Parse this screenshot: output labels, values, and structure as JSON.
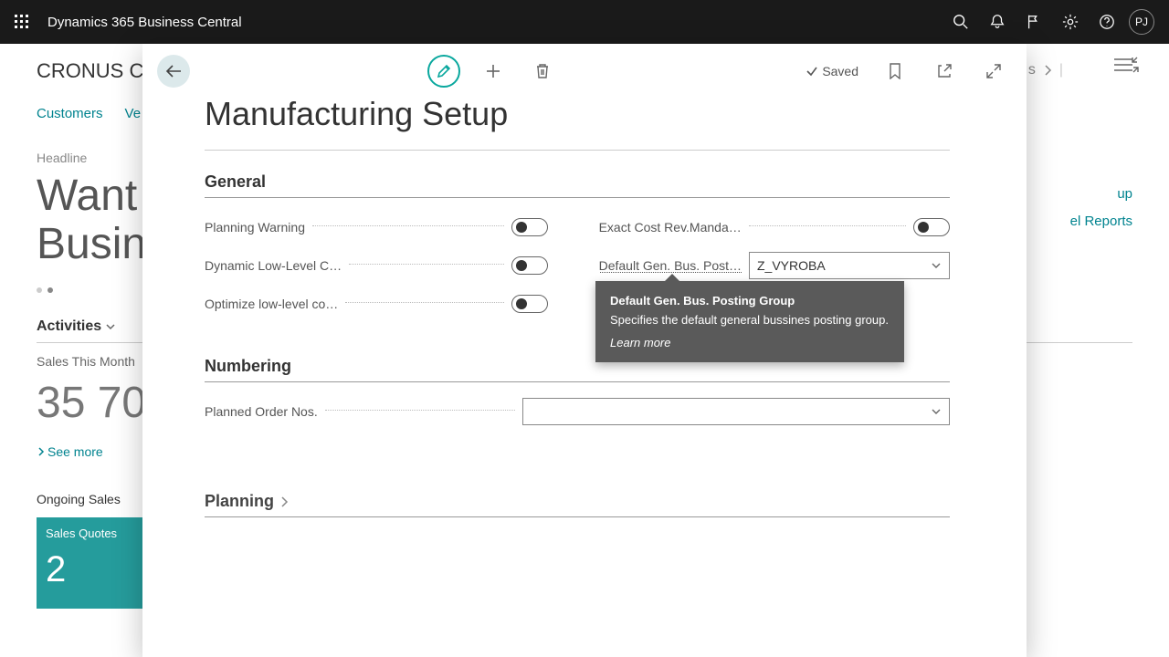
{
  "topbar": {
    "product": "Dynamics 365 Business Central",
    "avatar_initials": "PJ"
  },
  "background": {
    "company": "CRONUS CZ",
    "nav": {
      "customers": "Customers",
      "vendors_initial": "Ve"
    },
    "headline_label": "Headline",
    "headline_line1": "Want",
    "headline_line2": "Busine",
    "activities_header": "Activities",
    "sales_this_month_label": "Sales This Month",
    "sales_this_month_value": "35 70",
    "see_more": "See more",
    "ongoing_sales": "Ongoing Sales",
    "tile": {
      "label": "Sales Quotes",
      "value": "2"
    },
    "side_links": {
      "l1": "up",
      "l2": "el Reports"
    },
    "nav_suffix": "s"
  },
  "modal": {
    "title": "Manufacturing Setup",
    "saved_label": "Saved",
    "general": {
      "header": "General",
      "planning_warning": "Planning Warning",
      "dynamic_low_level": "Dynamic Low-Level C…",
      "optimize_low_level": "Optimize low-level co…",
      "exact_cost": "Exact Cost Rev.Manda…",
      "default_gbpg_label": "Default Gen. Bus. Post…",
      "default_gbpg_value": "Z_VYROBA"
    },
    "numbering": {
      "header": "Numbering",
      "planned_order_nos": "Planned Order Nos.",
      "planned_order_nos_value": ""
    },
    "planning": {
      "header": "Planning"
    },
    "tooltip": {
      "title": "Default Gen. Bus. Posting Group",
      "body": "Specifies the default general bussines posting group.",
      "learn": "Learn more"
    }
  }
}
